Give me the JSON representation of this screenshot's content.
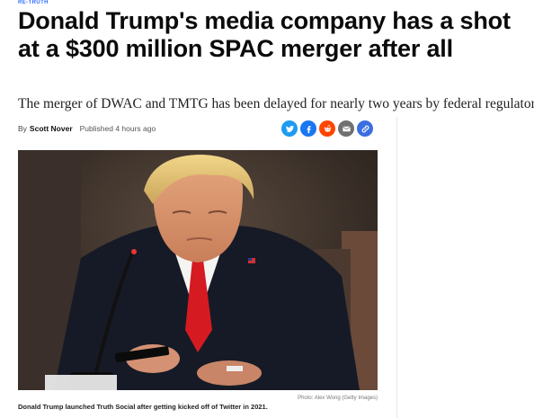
{
  "article": {
    "kicker": "RE-TRUTH",
    "headline": "Donald Trump's media company has a shot at a $300 million SPAC merger after all",
    "dek": "The merger of DWAC and TMTG has been delayed for nearly two years by federal regulators",
    "byline": {
      "prefix": "By",
      "author": "Scott Nover",
      "published": "Published 4 hours ago"
    },
    "share": [
      {
        "name": "twitter",
        "color": "#1d9bf0",
        "icon": "twitter-bird-icon"
      },
      {
        "name": "facebook",
        "color": "#1877f2",
        "icon": "facebook-icon"
      },
      {
        "name": "reddit",
        "color": "#ff4500",
        "icon": "reddit-icon"
      },
      {
        "name": "email",
        "color": "#707070",
        "icon": "envelope-icon"
      },
      {
        "name": "copy-link",
        "color": "#3b6fe0",
        "icon": "link-icon"
      }
    ],
    "image": {
      "credit": "Photo: Alex Wong (Getty Images)",
      "caption": "Donald Trump launched Truth Social after getting kicked off of Twitter in 2021."
    }
  }
}
